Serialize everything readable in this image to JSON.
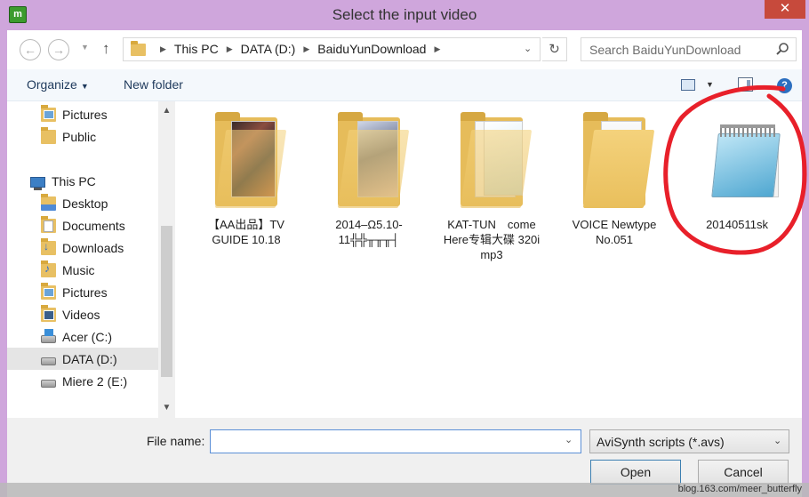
{
  "window": {
    "title": "Select the input video",
    "app_icon_label": "m",
    "close_symbol": "✕"
  },
  "nav": {
    "back_symbol": "←",
    "forward_symbol": "→",
    "recent_symbol": "▼",
    "up_symbol": "↑"
  },
  "address": {
    "crumbs": [
      "This PC",
      "DATA (D:)",
      "BaiduYunDownload"
    ],
    "separator": "▶",
    "dropdown_symbol": "⌄",
    "refresh_symbol": "↻"
  },
  "search": {
    "placeholder": "Search BaiduYunDownload"
  },
  "toolbar": {
    "organize": "Organize",
    "organize_caret": "▼",
    "new_folder": "New folder",
    "view_caret": "▼",
    "help_symbol": "?"
  },
  "sidebar": {
    "items": [
      {
        "label": "Pictures",
        "icon": "pictures-folder-icon"
      },
      {
        "label": "Public",
        "icon": "folder-icon"
      },
      {
        "label": "This PC",
        "icon": "computer-icon"
      },
      {
        "label": "Desktop",
        "icon": "desktop-folder-icon"
      },
      {
        "label": "Documents",
        "icon": "documents-folder-icon"
      },
      {
        "label": "Downloads",
        "icon": "downloads-folder-icon"
      },
      {
        "label": "Music",
        "icon": "music-folder-icon"
      },
      {
        "label": "Pictures",
        "icon": "pictures-folder-icon"
      },
      {
        "label": "Videos",
        "icon": "videos-folder-icon"
      },
      {
        "label": "Acer (C:)",
        "icon": "system-drive-icon"
      },
      {
        "label": "DATA (D:)",
        "icon": "drive-icon",
        "selected": true
      },
      {
        "label": "Miere 2 (E:)",
        "icon": "drive-icon"
      }
    ],
    "scroll_up": "▲",
    "scroll_down": "▼"
  },
  "files": [
    {
      "name": "【AA出品】TV GUIDE 10.18",
      "type": "folder"
    },
    {
      "name": "2014–Ω5.10-11╬╬╥╥╥┤",
      "type": "folder"
    },
    {
      "name": "KAT-TUN　come Here专辑大碟 320i mp3",
      "type": "folder"
    },
    {
      "name": "VOICE Newtype No.051",
      "type": "folder"
    },
    {
      "name": "20140511sk",
      "type": "notepad-file",
      "highlight": "#e8202a"
    }
  ],
  "bottom": {
    "filename_label": "File name:",
    "filename_value": "",
    "filename_caret": "⌄",
    "filter": "AviSynth scripts (*.avs)",
    "filter_caret": "⌄",
    "open": "Open",
    "cancel": "Cancel"
  },
  "watermark": "blog.163.com/meer_butterfly"
}
